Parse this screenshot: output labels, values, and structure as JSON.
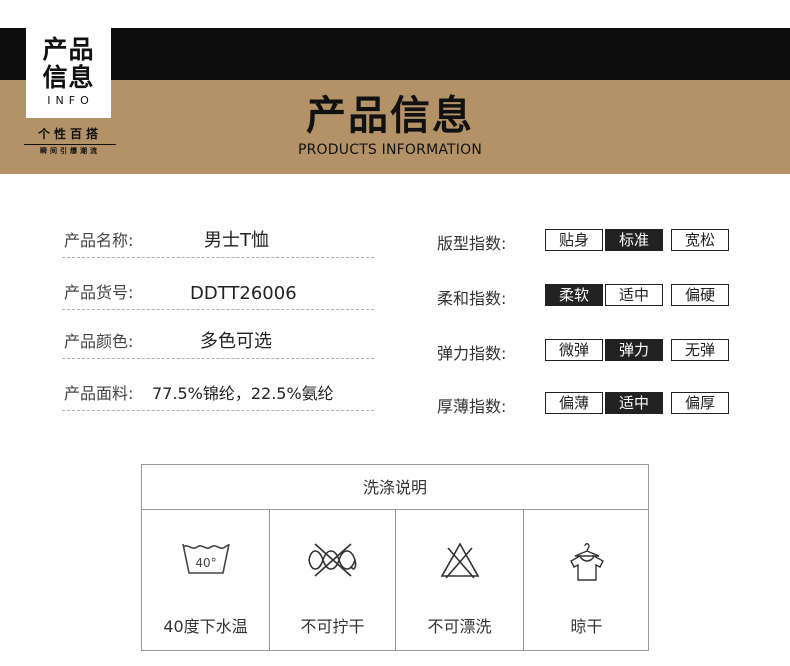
{
  "header": {
    "badge_line1": "产品",
    "badge_line2": "信息",
    "badge_line3": "INFO",
    "tagline": "个性百搭",
    "tagline_sub": "瞬间引爆潮流",
    "title": "产品信息",
    "subtitle": "PRODUCTS INFORMATION",
    "colors": {
      "black_band": "#0d0d0d",
      "tan_band": "#b49268"
    }
  },
  "info": [
    {
      "label": "产品名称:",
      "value": "男士T恤"
    },
    {
      "label": "产品货号:",
      "value": "DDTT26006"
    },
    {
      "label": "产品颜色:",
      "value": "多色可选"
    },
    {
      "label": "产品面料:",
      "value": "77.5%锦纶，22.5%氨纶"
    }
  ],
  "indices": [
    {
      "label": "版型指数:",
      "options": [
        "贴身",
        "标准",
        "宽松"
      ],
      "selected": "标准"
    },
    {
      "label": "柔和指数:",
      "options": [
        "柔软",
        "适中",
        "偏硬"
      ],
      "selected": "柔软"
    },
    {
      "label": "弹力指数:",
      "options": [
        "微弹",
        "弹力",
        "无弹"
      ],
      "selected": "弹力"
    },
    {
      "label": "厚薄指数:",
      "options": [
        "偏薄",
        "适中",
        "偏厚"
      ],
      "selected": "适中"
    }
  ],
  "care": {
    "title": "洗涤说明",
    "items": [
      {
        "icon": "wash-40-icon",
        "icon_text": "40°",
        "label": "40度下水温"
      },
      {
        "icon": "no-wring-icon",
        "label": "不可拧干"
      },
      {
        "icon": "no-bleach-icon",
        "label": "不可漂洗"
      },
      {
        "icon": "hang-dry-icon",
        "label": "晾干"
      }
    ]
  }
}
